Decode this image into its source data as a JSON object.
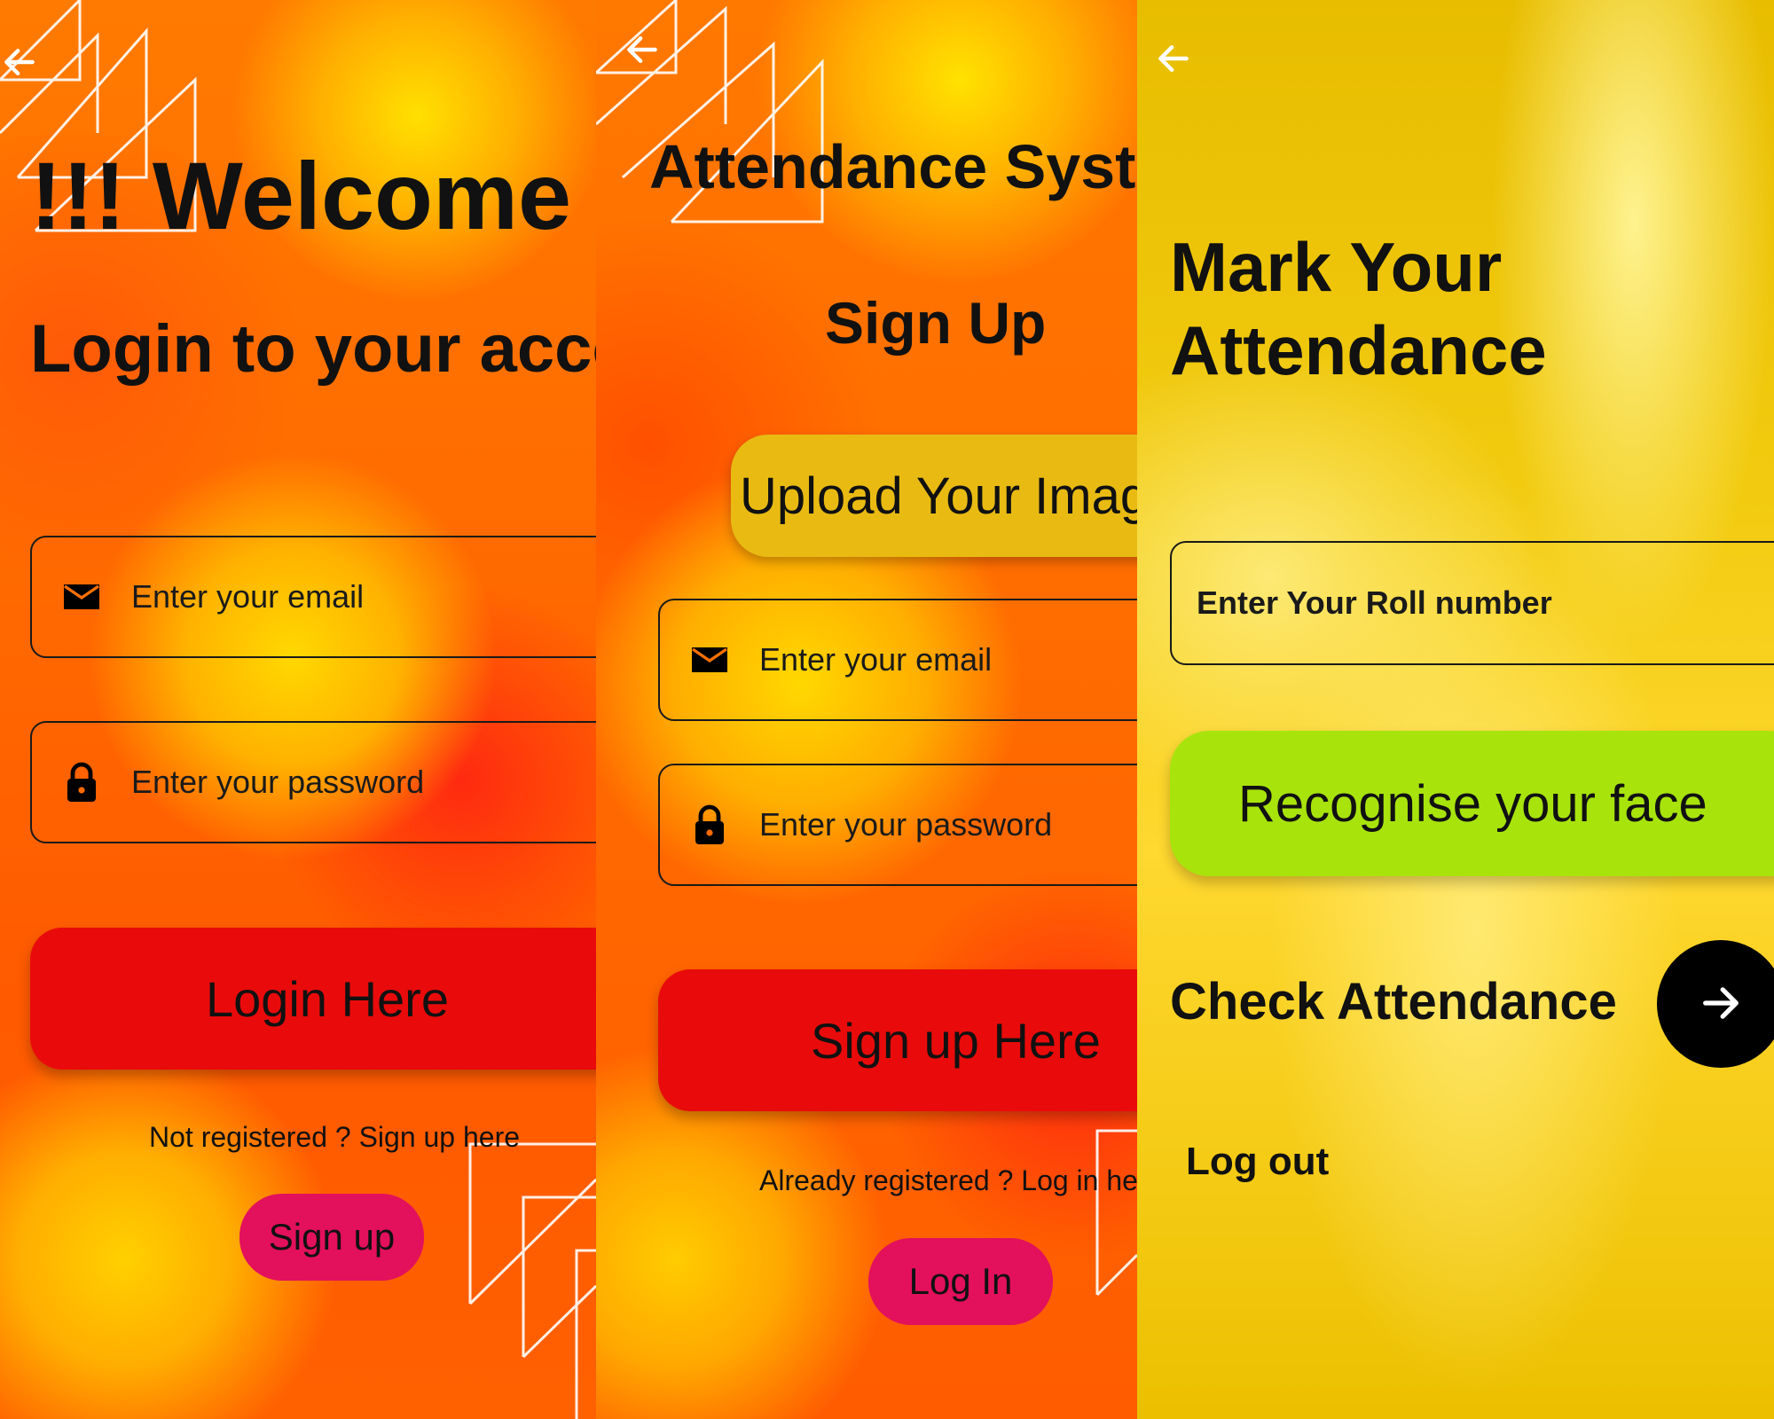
{
  "colors": {
    "accent_red": "#e90b0b",
    "pill_pink": "#e3105c",
    "upload_gold": "#e9bb12",
    "recognise_green": "#a8e40c",
    "black": "#000000"
  },
  "login": {
    "back_icon": "arrow-left-icon",
    "welcome": "!!! Welcome !!!",
    "subtitle": "Login to your account",
    "email_icon": "envelope-icon",
    "email_placeholder": "Enter your email",
    "password_icon": "lock-icon",
    "password_placeholder": "Enter your password",
    "login_button": "Login Here",
    "register_prompt": "Not registered ? Sign up here",
    "signup_button": "Sign up"
  },
  "signup": {
    "back_icon": "arrow-left-icon",
    "app_title": "Attendance System",
    "heading": "Sign Up",
    "upload_button": "Upload Your Image",
    "email_icon": "envelope-icon",
    "email_placeholder": "Enter your email",
    "password_icon": "lock-icon",
    "password_placeholder": "Enter your password",
    "signup_button": "Sign up Here",
    "login_prompt": "Already registered ? Log in here",
    "login_button": "Log In"
  },
  "attendance": {
    "back_icon": "arrow-left-icon",
    "title_line1": "Mark Your",
    "title_line2": "Attendance",
    "roll_placeholder": "Enter Your Roll number",
    "recognise_button": "Recognise your face",
    "check_label": "Check Attendance",
    "check_icon": "arrow-right-icon",
    "logout": "Log out"
  }
}
